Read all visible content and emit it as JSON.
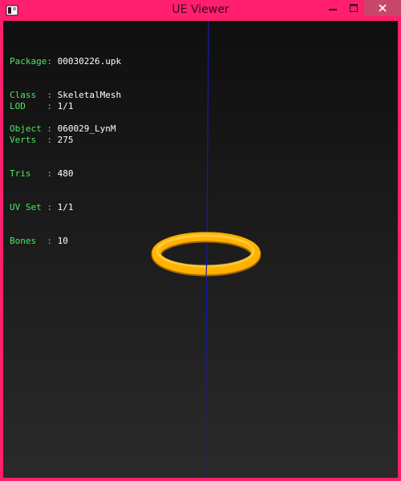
{
  "window": {
    "title": "UE Viewer",
    "icon": "ue-viewer-app-icon",
    "frame_color": "#ff1f6e"
  },
  "info": {
    "package": {
      "label": "Package:",
      "value": "00030226.upk"
    },
    "class": {
      "label": "Class  :",
      "value": "SkeletalMesh"
    },
    "object": {
      "label": "Object :",
      "value": "060029_LynM"
    },
    "lod": {
      "label": "LOD    :",
      "value": "1/1"
    },
    "verts": {
      "label": "Verts  :",
      "value": "275"
    },
    "tris": {
      "label": "Tris   :",
      "value": "480"
    },
    "uvset": {
      "label": "UV Set :",
      "value": "1/1"
    },
    "bones": {
      "label": "Bones  :",
      "value": "10"
    }
  },
  "colors": {
    "label_text": "#49e85e",
    "value_text": "#ffffff",
    "mesh": "#ffb300",
    "axis": "#1a1aa8"
  }
}
